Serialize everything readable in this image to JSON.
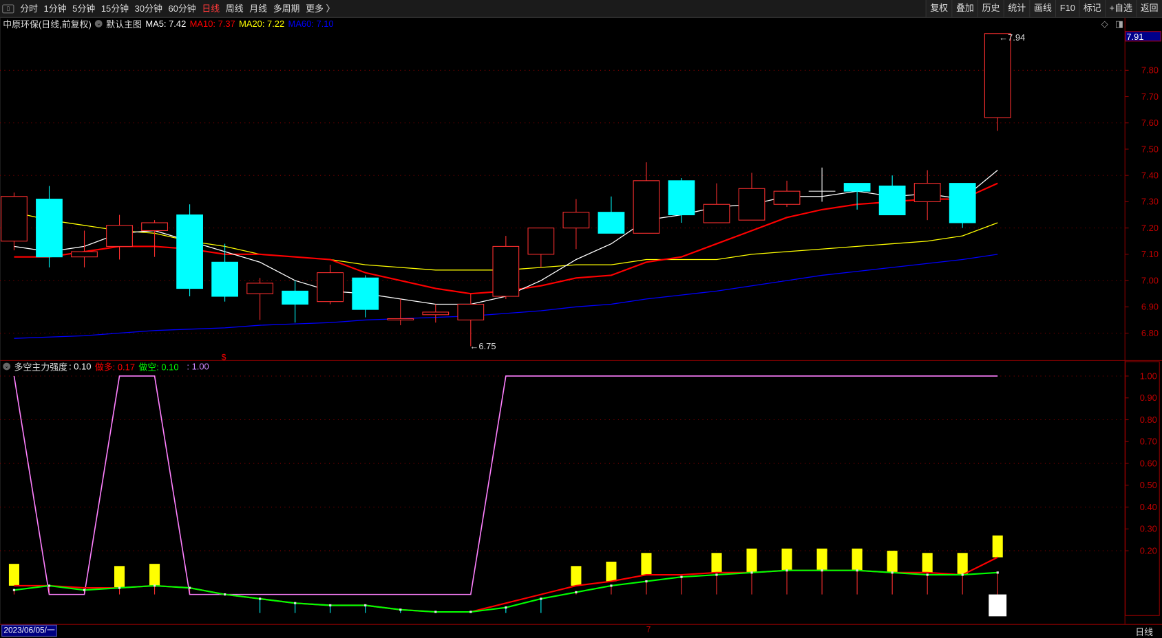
{
  "toolbar": {
    "periods": [
      "分时",
      "1分钟",
      "5分钟",
      "15分钟",
      "30分钟",
      "60分钟",
      "日线",
      "周线",
      "月线",
      "多周期",
      "更多 〉"
    ],
    "active_period": "日线",
    "actions": [
      "复权",
      "叠加",
      "历史",
      "统计",
      "画线",
      "F10",
      "标记",
      "+自选",
      "返回"
    ]
  },
  "main_legend": {
    "title": "中原环保(日线,前复权)",
    "template": "默认主图",
    "ma5": "MA5: 7.42",
    "ma10": "MA10: 7.37",
    "ma20": "MA20: 7.22",
    "ma60": "MA60: 7.10"
  },
  "sub_legend": {
    "title": "多空主力强度",
    "value": ": 0.10",
    "long_label": "做多: 0.17",
    "short_label": "做空: 0.10",
    "extra": ": 1.00"
  },
  "colors": {
    "up": "#ff3030",
    "down": "#00ffff",
    "ma5": "#ffffff",
    "ma10": "#ff0000",
    "ma20": "#ffff00",
    "ma60": "#0000ff",
    "strength": "#ff80ff",
    "long": "#ff0000",
    "short": "#00ff00",
    "bar": "#ffff00",
    "grid": "#8b0000",
    "axis_text": "#c00000"
  },
  "price_axis": {
    "current": "7.91",
    "ticks": [
      "7.80",
      "7.70",
      "7.60",
      "7.50",
      "7.40",
      "7.30",
      "7.20",
      "7.10",
      "7.00",
      "6.90",
      "6.80"
    ]
  },
  "sub_axis": {
    "ticks": [
      "1.00",
      "0.90",
      "0.80",
      "0.70",
      "0.60",
      "0.50",
      "0.40",
      "0.30",
      "0.20"
    ]
  },
  "annotations": {
    "high": "7.94",
    "low": "6.75",
    "marker": "$"
  },
  "bottom": {
    "date": "2023/06/05/一",
    "mid_tick": "7",
    "period": "日线"
  },
  "chart_data": {
    "type": "candlestick",
    "ylim": [
      6.72,
      7.98
    ],
    "candles": [
      [
        7.15,
        7.335,
        7.115,
        7.32
      ],
      [
        7.31,
        7.36,
        7.05,
        7.09
      ],
      [
        7.09,
        7.19,
        7.05,
        7.11
      ],
      [
        7.13,
        7.25,
        7.08,
        7.21
      ],
      [
        7.19,
        7.23,
        7.09,
        7.22
      ],
      [
        7.25,
        7.29,
        6.94,
        6.97
      ],
      [
        7.07,
        7.14,
        6.92,
        6.94
      ],
      [
        6.95,
        7.01,
        6.85,
        6.99
      ],
      [
        6.96,
        7.0,
        6.84,
        6.91
      ],
      [
        6.92,
        7.06,
        6.91,
        7.03
      ],
      [
        7.01,
        7.02,
        6.86,
        6.89
      ],
      [
        6.85,
        6.93,
        6.83,
        6.855
      ],
      [
        6.87,
        6.91,
        6.84,
        6.88
      ],
      [
        6.85,
        6.95,
        6.75,
        6.91
      ],
      [
        6.94,
        7.17,
        6.93,
        7.13
      ],
      [
        7.1,
        7.2,
        7.05,
        7.2
      ],
      [
        7.2,
        7.31,
        7.12,
        7.26
      ],
      [
        7.26,
        7.32,
        7.18,
        7.18
      ],
      [
        7.18,
        7.45,
        7.18,
        7.38
      ],
      [
        7.38,
        7.39,
        7.22,
        7.25
      ],
      [
        7.22,
        7.37,
        7.22,
        7.29
      ],
      [
        7.23,
        7.41,
        7.23,
        7.35
      ],
      [
        7.29,
        7.38,
        7.28,
        7.34
      ],
      [
        7.34,
        7.43,
        7.3,
        7.34
      ],
      [
        7.37,
        7.37,
        7.27,
        7.34
      ],
      [
        7.36,
        7.4,
        7.25,
        7.25
      ],
      [
        7.3,
        7.42,
        7.23,
        7.37
      ],
      [
        7.37,
        7.37,
        7.2,
        7.22
      ],
      [
        7.62,
        7.94,
        7.57,
        7.94
      ]
    ],
    "candle_format": [
      "open",
      "high",
      "low",
      "close"
    ],
    "ma5": [
      7.13,
      7.11,
      7.13,
      7.18,
      7.19,
      7.15,
      7.11,
      7.07,
      7.0,
      6.96,
      6.95,
      6.93,
      6.91,
      6.91,
      6.94,
      7.0,
      7.08,
      7.14,
      7.23,
      7.25,
      7.28,
      7.29,
      7.32,
      7.32,
      7.34,
      7.32,
      7.33,
      7.31,
      7.42
    ],
    "ma10": [
      7.09,
      7.09,
      7.11,
      7.13,
      7.13,
      7.12,
      7.1,
      7.1,
      7.09,
      7.08,
      7.03,
      7.0,
      6.97,
      6.95,
      6.96,
      6.98,
      7.01,
      7.02,
      7.07,
      7.09,
      7.14,
      7.19,
      7.24,
      7.27,
      7.29,
      7.3,
      7.31,
      7.31,
      7.37
    ],
    "ma20": [
      7.26,
      7.23,
      7.21,
      7.19,
      7.18,
      7.15,
      7.13,
      7.1,
      7.09,
      7.08,
      7.06,
      7.05,
      7.04,
      7.04,
      7.04,
      7.05,
      7.06,
      7.06,
      7.08,
      7.08,
      7.08,
      7.1,
      7.11,
      7.12,
      7.13,
      7.14,
      7.15,
      7.17,
      7.22
    ],
    "ma60": [
      6.78,
      6.785,
      6.79,
      6.8,
      6.81,
      6.815,
      6.82,
      6.83,
      6.835,
      6.84,
      6.85,
      6.855,
      6.86,
      6.865,
      6.875,
      6.885,
      6.9,
      6.91,
      6.93,
      6.945,
      6.96,
      6.98,
      7.0,
      7.02,
      7.035,
      7.05,
      7.065,
      7.08,
      7.1
    ],
    "sub": {
      "ylim": [
        -0.12,
        1.05
      ],
      "strength": [
        1,
        0,
        0,
        1,
        1,
        0,
        0,
        0,
        0,
        0,
        0,
        0,
        0,
        0,
        1,
        1,
        1,
        1,
        1,
        1,
        1,
        1,
        1,
        1,
        1,
        1,
        1,
        1,
        1
      ],
      "long": [
        0.04,
        0.04,
        0.03,
        0.03,
        0.04,
        0.03,
        0,
        -0.02,
        -0.04,
        -0.05,
        -0.05,
        -0.07,
        -0.08,
        -0.08,
        -0.04,
        0.0,
        0.04,
        0.06,
        0.09,
        0.09,
        0.1,
        0.1,
        0.11,
        0.11,
        0.11,
        0.1,
        0.1,
        0.09,
        0.17
      ],
      "short": [
        0.02,
        0.04,
        0.02,
        0.03,
        0.04,
        0.03,
        0,
        -0.02,
        -0.04,
        -0.05,
        -0.05,
        -0.07,
        -0.08,
        -0.08,
        -0.06,
        -0.02,
        0.01,
        0.04,
        0.06,
        0.08,
        0.09,
        0.1,
        0.11,
        0.11,
        0.11,
        0.1,
        0.09,
        0.09,
        0.1
      ],
      "bar_tops": [
        0.14,
        null,
        null,
        0.13,
        0.14,
        null,
        null,
        null,
        null,
        null,
        null,
        null,
        null,
        null,
        null,
        null,
        0.13,
        0.15,
        0.19,
        null,
        0.19,
        0.21,
        0.21,
        0.21,
        0.21,
        0.2,
        0.19,
        0.19,
        0.27
      ],
      "last_block": -0.1
    }
  }
}
